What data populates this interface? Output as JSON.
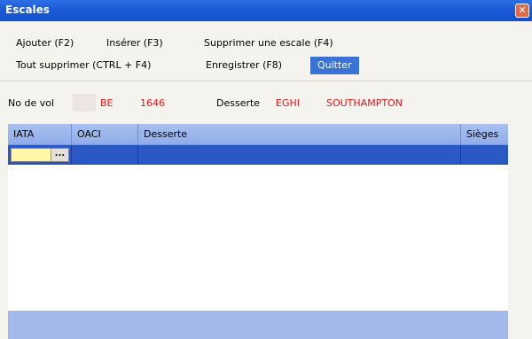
{
  "window": {
    "title": "Escales",
    "close_glyph": "✕",
    "close_icon": "close-icon"
  },
  "menu": {
    "ajouter": "Ajouter (F2)",
    "inserer": "Insérer (F3)",
    "supprimer_escale": "Supprimer une escale (F4)",
    "tout_supprimer": "Tout supprimer (CTRL + F4)",
    "enregistrer": "Enregistrer (F8)",
    "quitter": "Quitter"
  },
  "flight": {
    "no_de_vol_label": "No de vol",
    "airline_code": "BE",
    "flight_number": "1646",
    "desserte_label": "Desserte",
    "desserte_code": "EGHI",
    "desserte_name": "SOUTHAMPTON"
  },
  "grid": {
    "columns": [
      "IATA",
      "OACI",
      "Desserte",
      "Sièges"
    ],
    "ellipsis": "...",
    "ellipsis_icon": "ellipsis-icon"
  },
  "colors": {
    "titlebar": "#1b5ad8",
    "accent_red": "#e8141a",
    "selected_row": "#2b59c4",
    "edit_cell": "#fff7a6",
    "active_menu": "#3a72d6"
  }
}
